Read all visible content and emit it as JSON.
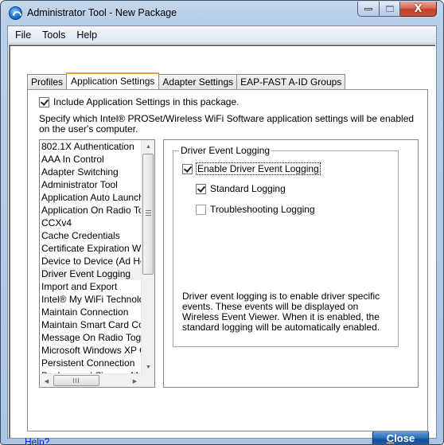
{
  "window": {
    "title": "Administrator Tool - New Package",
    "icon": "wifi-globe-icon",
    "controls": {
      "minimize": "minimize-icon",
      "maximize": "maximize-icon",
      "close_glyph": "X"
    }
  },
  "menubar": {
    "items": [
      {
        "label": "File"
      },
      {
        "label": "Tools"
      },
      {
        "label": "Help"
      }
    ]
  },
  "tabs": [
    {
      "label": "Profiles",
      "active": false
    },
    {
      "label": "Application Settings",
      "active": true
    },
    {
      "label": "Adapter Settings",
      "active": false
    },
    {
      "label": "EAP-FAST A-ID Groups",
      "active": false
    }
  ],
  "app_settings": {
    "include_checkbox": {
      "label": "Include Application Settings in this package.",
      "checked": true
    },
    "description": "Specify which Intel® PROSet/Wireless WiFi Software application settings will be enabled on the user's computer.",
    "settings_list": {
      "items": [
        "802.1X Authentication",
        "AAA In Control",
        "Adapter Switching",
        "Administrator Tool",
        "Application Auto Launch",
        "Application On Radio Toggle",
        "CCXv4",
        "Cache Credentials",
        "Certificate Expiration Warning",
        "Device to Device (Ad Hoc)",
        "Driver Event Logging",
        "Import and Export",
        "Intel® My WiFi Technology",
        "Maintain Connection",
        "Maintain Smart Card Connection",
        "Message On Radio Toggle",
        "Microsoft Windows XP Coexistence",
        "Persistent Connection",
        "Background Sign-on Mode"
      ],
      "selected": "Driver Event Logging"
    },
    "detail": {
      "group_title": "Driver Event Logging",
      "options": [
        {
          "label": "Enable Driver Event Logging",
          "checked": true,
          "focused": true
        },
        {
          "label": "Standard Logging",
          "checked": true
        },
        {
          "label": "Troubleshooting Logging",
          "checked": false
        }
      ],
      "description": "Driver event logging is to enable driver specific events. These events will be displayed on Wireless Event Viewer. When it is enabled, the standard logging will be automatically enabled."
    }
  },
  "footer": {
    "help_link": "Help?",
    "close_button": {
      "accel": "C",
      "rest": "lose"
    }
  },
  "colors": {
    "active_tab_accent": "#e8a13a",
    "help_link": "#0a14c8",
    "close_button": "#1d64b3",
    "title_close": "#c7503a"
  }
}
